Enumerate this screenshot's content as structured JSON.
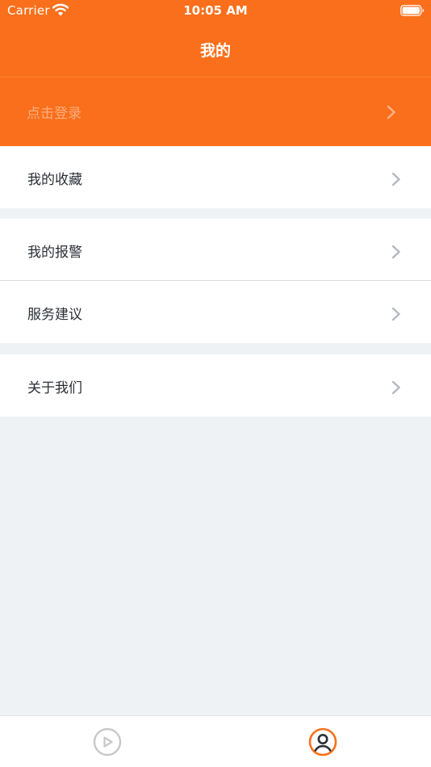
{
  "status_bar": {
    "carrier": "Carrier",
    "time": "10:05 AM"
  },
  "nav": {
    "title": "我的"
  },
  "login": {
    "label": "点击登录"
  },
  "menu": {
    "favorites": "我的收藏",
    "alarms": "我的报警",
    "suggestions": "服务建议",
    "about": "关于我们"
  },
  "tab_bar": {
    "active_index": 1,
    "tabs": [
      {
        "icon": "play-icon"
      },
      {
        "icon": "profile-icon"
      }
    ]
  },
  "colors": {
    "brand": "#fa6f1b",
    "background": "#eff2f5",
    "text": "#2b2f36",
    "chevron": "#b4b8bf",
    "inactive_tab": "#c8c8c8"
  }
}
